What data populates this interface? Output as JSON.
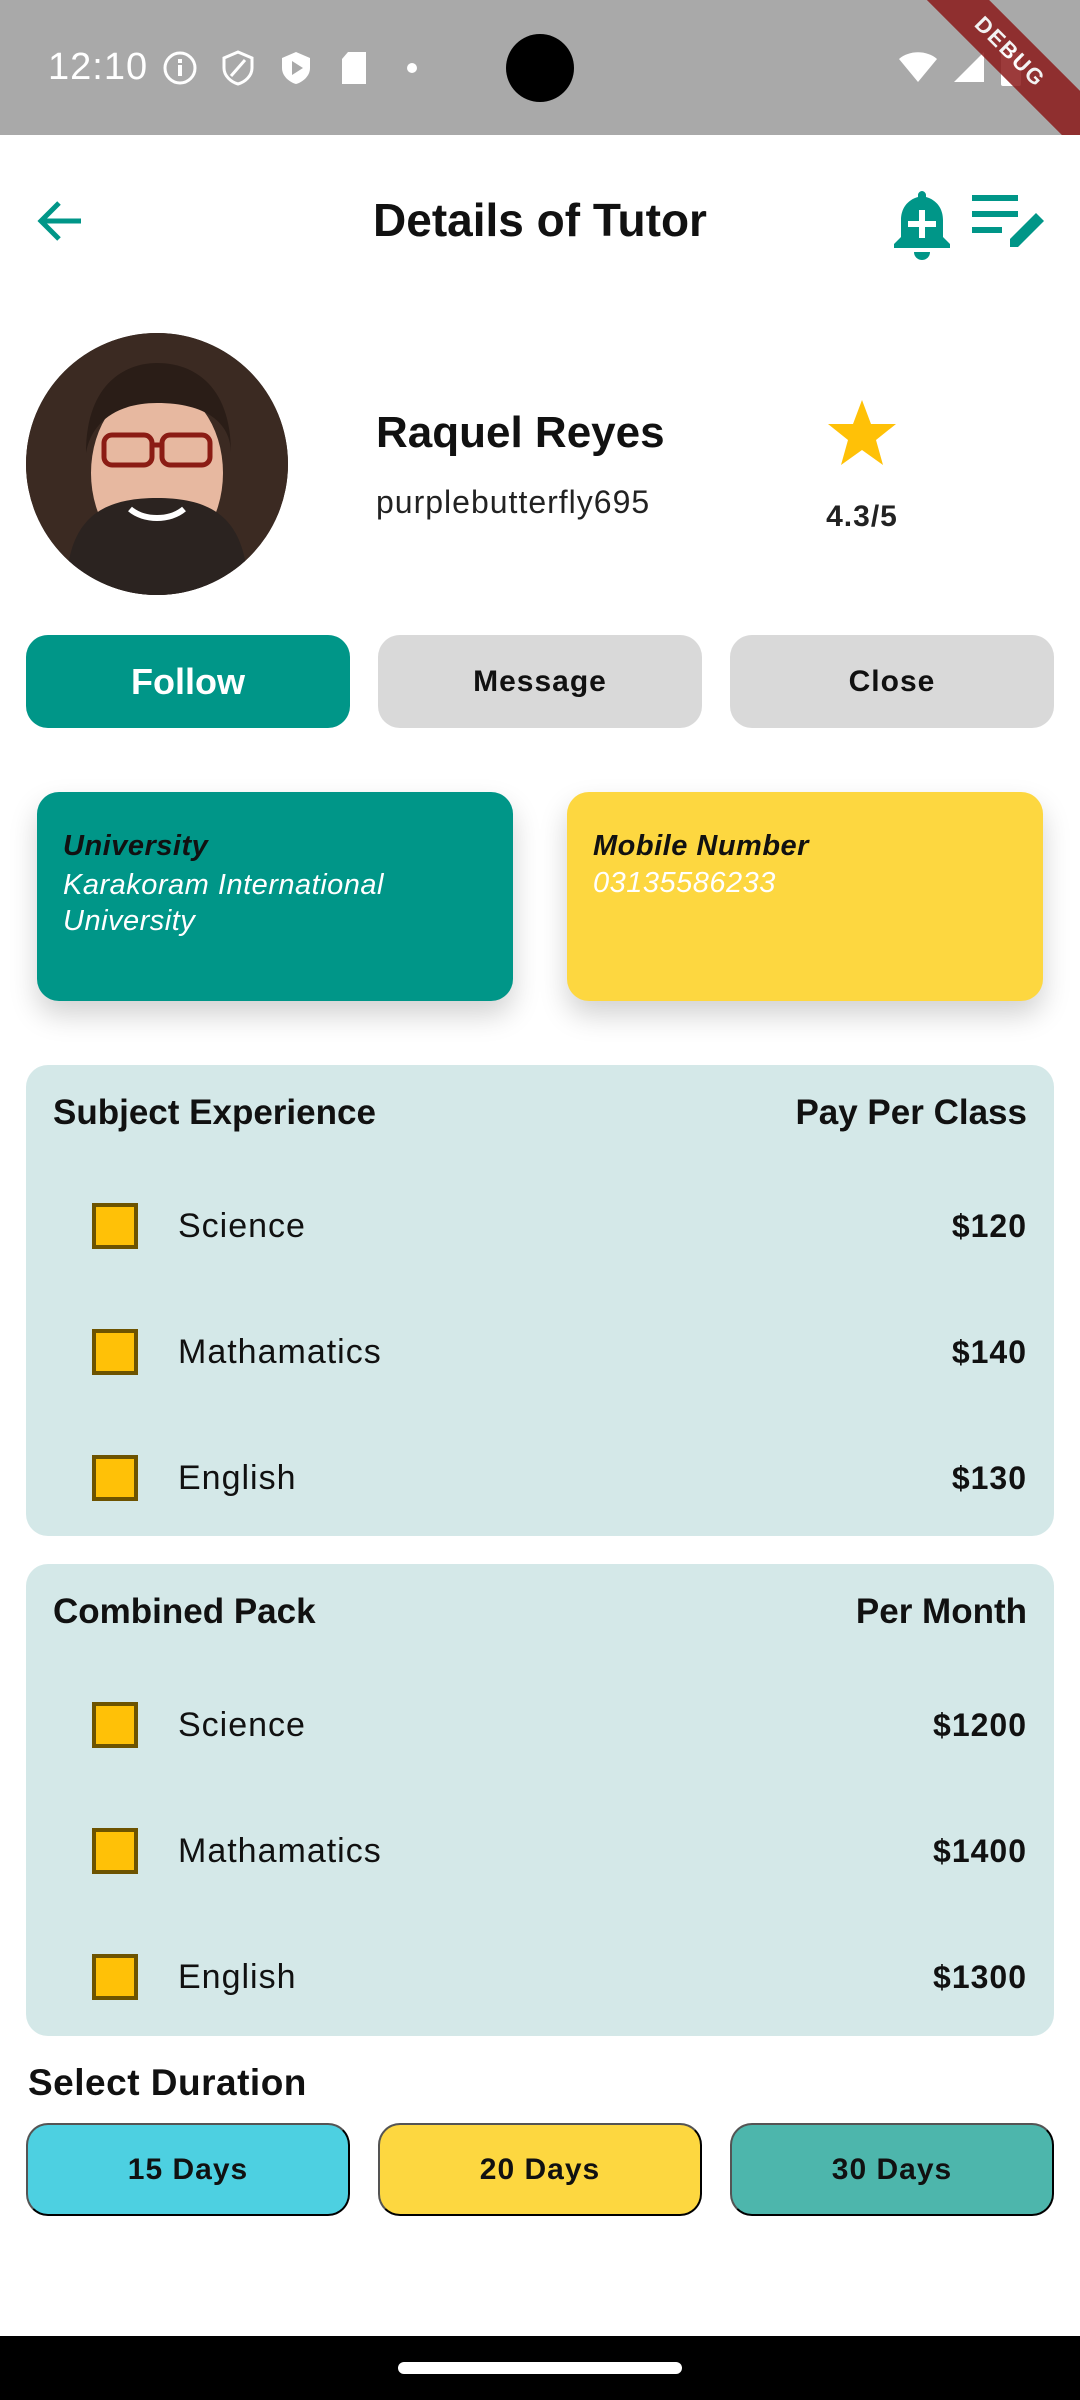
{
  "status_bar": {
    "time": "12:10",
    "debug_label": "DEBUG",
    "icons_left": [
      "info-icon",
      "shield-icon",
      "play-protect-icon",
      "sd-card-icon",
      "dot-icon"
    ],
    "icons_right": [
      "wifi-icon",
      "signal-icon",
      "battery-icon"
    ]
  },
  "app_bar": {
    "title": "Details of Tutor",
    "accent_color": "#009688"
  },
  "profile": {
    "name": "Raquel Reyes",
    "username": "purplebutterfly695",
    "rating": "4.3/5",
    "star_color": "#ffc107"
  },
  "actions": {
    "follow": "Follow",
    "message": "Message",
    "close": "Close"
  },
  "info_cards": {
    "university_label": "University",
    "university_value": "Karakoram International University",
    "mobile_label": "Mobile Number",
    "mobile_value": "03135586233"
  },
  "subjects": {
    "heading": "Subject Experience",
    "price_heading": "Pay Per Class",
    "rows": [
      {
        "label": "Science",
        "price": "$120"
      },
      {
        "label": "Mathamatics",
        "price": "$140"
      },
      {
        "label": "English",
        "price": "$130"
      }
    ]
  },
  "combined": {
    "heading": "Combined Pack",
    "price_heading": "Per Month",
    "rows": [
      {
        "label": "Science",
        "price": "$1200"
      },
      {
        "label": "Mathamatics",
        "price": "$1400"
      },
      {
        "label": "English",
        "price": "$1300"
      }
    ]
  },
  "duration": {
    "title": "Select Duration",
    "options": [
      "15 Days",
      "20 Days",
      "30 Days"
    ]
  }
}
